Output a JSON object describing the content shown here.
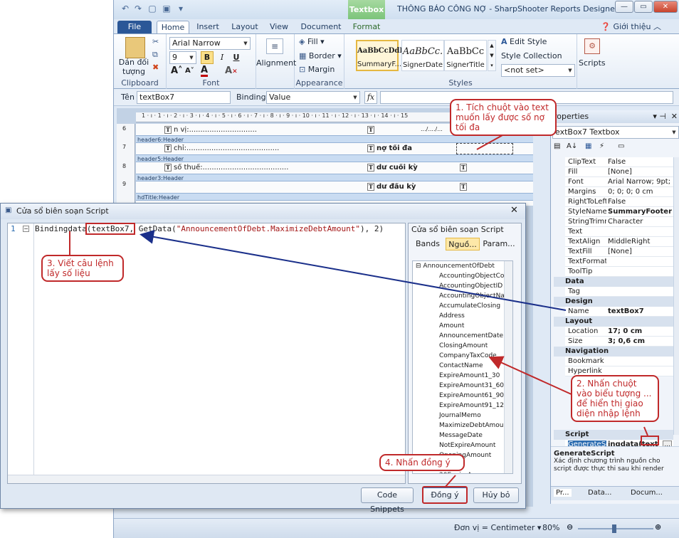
{
  "titlebar": {
    "context_tab": "Textbox",
    "title": "THÔNG BÁO CÔNG NỢ - SharpShooter Reports Designer",
    "minimize": "—",
    "maximize": "▭",
    "close": "✕"
  },
  "tabs": [
    "File",
    "Home",
    "Insert",
    "Layout",
    "View",
    "Document",
    "Format"
  ],
  "help": {
    "label": "Giới thiệu"
  },
  "ribbon": {
    "clipboard": {
      "label": "Clipboard",
      "paste": "Dán đối tượng"
    },
    "font": {
      "label": "Font",
      "family": "Arial Narrow",
      "size": "9",
      "bold": "B",
      "italic": "I",
      "underline": "U"
    },
    "alignment": {
      "label": "Alignment"
    },
    "appearance": {
      "label": "Appearance",
      "fill": "Fill",
      "border": "Border",
      "margin": "Margin"
    },
    "styles": {
      "label": "Styles",
      "items": [
        {
          "preview": "AaBbCcDdE",
          "name": "SummaryF..."
        },
        {
          "preview": "AaBbCc.",
          "name": "SignerDate"
        },
        {
          "preview": "AaBbCc",
          "name": "SignerTitle"
        }
      ],
      "edit_style": "Edit Style",
      "style_collection": "Style Collection",
      "not_set": "<not set>"
    },
    "scripts": {
      "label": "Scripts"
    }
  },
  "formula_bar": {
    "name_label": "Tên",
    "name_value": "textBox7",
    "binding_label": "Binding",
    "binding_value": "Value",
    "fx": "fx"
  },
  "designer": {
    "ruler": "1 · ı · 1 · ı · 2 · ı · 3 · ı · 4 · ı · 5 · ı · 6 · ı · 7 · ı · 8 · ı · 9 · ı · 10 · ı · 11 · ı · 12 · ı · 13 · ı · 14 · ı · 15",
    "row_numbers": [
      "6",
      "7",
      "8",
      "9"
    ],
    "bands": [
      "header6:Header",
      "header5:Header",
      "header3:Header",
      "hdTitle:Header"
    ],
    "cells": [
      "n vị:..............................",
      "chỉ:.........................................",
      "số thuế:......................................",
      "nợ tối đa",
      "dư cuối kỳ",
      "dư đầu kỳ",
      ".../..../..."
    ]
  },
  "properties": {
    "title": "roperties",
    "object": "extBox7 Textbox",
    "rows1": [
      [
        "ClipText",
        "False"
      ],
      [
        "Fill",
        "[None]"
      ],
      [
        "Font",
        "Arial Narrow; 9pt;"
      ],
      [
        "Margins",
        "0; 0; 0; 0 cm"
      ],
      [
        "RightToLeft",
        "False"
      ],
      [
        "StyleName",
        "SummaryFooter"
      ],
      [
        "StringTrimmin",
        "Character"
      ],
      [
        "Text",
        ""
      ],
      [
        "TextAlign",
        "MiddleRight"
      ],
      [
        "TextFill",
        "[None]"
      ],
      [
        "TextFormat",
        ""
      ],
      [
        "ToolTip",
        ""
      ]
    ],
    "cat_data": "Data",
    "rows_data": [
      [
        "Tag",
        ""
      ]
    ],
    "cat_design": "Design",
    "rows_design": [
      [
        "Name",
        "textBox7"
      ]
    ],
    "cat_layout": "Layout",
    "rows_layout": [
      [
        "Location",
        "17; 0 cm"
      ],
      [
        "Size",
        "3; 0,6 cm"
      ]
    ],
    "cat_nav": "Navigation",
    "rows_nav": [
      [
        "Bookmark",
        ""
      ],
      [
        "Hyperlink",
        ""
      ]
    ],
    "cat_script": "Script",
    "script_row": [
      "GenerateScri",
      "ingdata(text"
    ],
    "desc_title": "GenerateScript",
    "desc_text": "Xác định chương trình nguồn cho script được thực thi sau khi render",
    "bottom_tabs": [
      "Pr...",
      "Data...",
      "Docum..."
    ]
  },
  "dialog": {
    "title": "Cửa sổ biên soạn Script",
    "line_no": "1",
    "code_plain": "Bindingdata",
    "code_box": "(textBox7,",
    "code_rest": " GetData(",
    "code_string": "\"AnnouncementOfDebt.MaximizeDebtAmount\"",
    "code_tail": "), 2)",
    "panel_title": "Cửa sổ biên soạn Script",
    "panel_tabs": [
      "Bands",
      "Nguồ...",
      "Param..."
    ],
    "tree_root": "AnnouncementOfDebt",
    "tree_items": [
      "AccountingObjectCode",
      "AccountingObjectID",
      "AccountingObjectName",
      "AccumulateClosing",
      "Address",
      "Amount",
      "AnnouncementDate",
      "ClosingAmount",
      "CompanyTaxCode",
      "ContactName",
      "ExpireAmount1_30",
      "ExpireAmount31_60",
      "ExpireAmount61_90",
      "ExpireAmount91_120",
      "JournalMemo",
      "MaximizeDebtAmount",
      "MessageDate",
      "NotExpireAmount",
      "OpeningAmount",
      "Type",
      "20ExpireAmour"
    ],
    "buttons": {
      "snippets": "Code Snippets",
      "ok": "Đồng ý",
      "cancel": "Hủy bỏ"
    }
  },
  "status": {
    "unit": "Đơn vị = Centimeter",
    "zoom": "80%"
  },
  "callouts": {
    "c1": "1. Tích chuột vào text muốn lấy được số nợ tối đa",
    "c2": "2. Nhấn chuột vào biểu tượng ... để hiển thị giao diện nhập lệnh",
    "c3": "3. Viết câu lệnh lấy số liệu",
    "c4": "4. Nhấn đồng ý"
  },
  "colors": {
    "accent": "#2b5797",
    "callout": "#c0292a",
    "arrow": "#1a2f8a"
  }
}
